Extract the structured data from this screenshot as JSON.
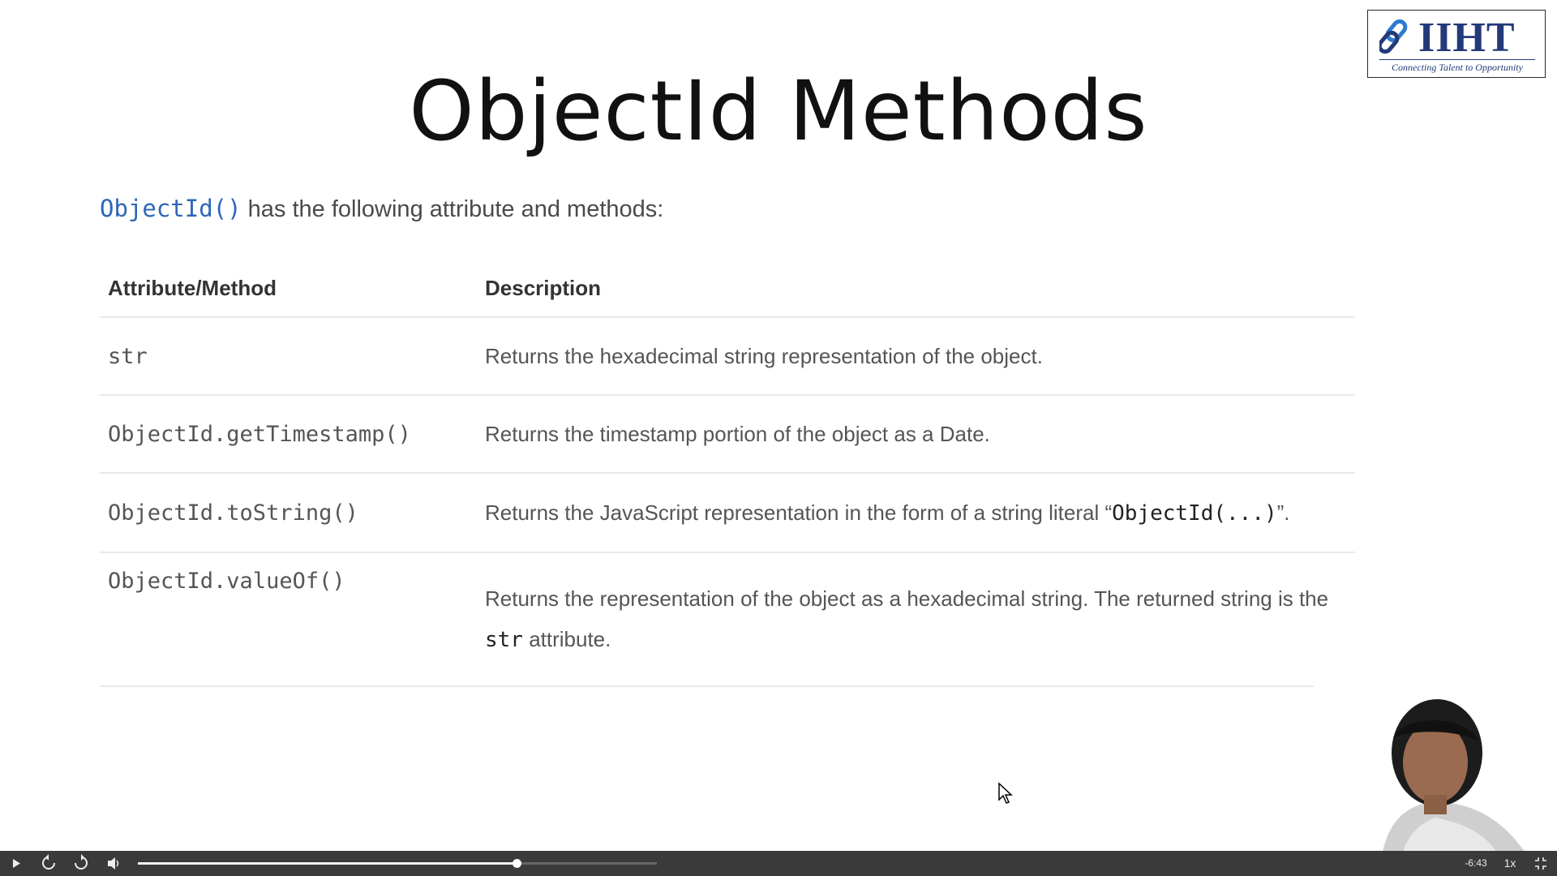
{
  "logo": {
    "brand": "IIHT",
    "tagline": "Connecting Talent to Opportunity",
    "icon": "chain-link-icon"
  },
  "slide": {
    "title": "ObjectId Methods",
    "intro_code": "ObjectId()",
    "intro_text": " has the following attribute and methods:"
  },
  "table": {
    "headers": [
      "Attribute/Method",
      "Description"
    ],
    "rows": [
      {
        "name": "str",
        "desc": "Returns the hexadecimal string representation of the object."
      },
      {
        "name": "ObjectId.getTimestamp()",
        "desc": "Returns the timestamp portion of the object as a Date."
      },
      {
        "name": "ObjectId.toString()",
        "desc_before": "Returns the JavaScript representation in the form of a string literal “",
        "desc_code": "ObjectId(...)",
        "desc_after": "”."
      },
      {
        "name": "ObjectId.valueOf()",
        "desc_before": "Returns the representation of the object as a hexadecimal string. The returned string is the ",
        "desc_code": "str",
        "desc_after": " attribute."
      }
    ]
  },
  "player": {
    "time_remaining": "-6:43",
    "speed": "1x",
    "progress_fraction": 0.73,
    "icons": [
      "play-icon",
      "rewind-icon",
      "forward-icon",
      "volume-icon",
      "fullscreen-exit-icon"
    ]
  }
}
